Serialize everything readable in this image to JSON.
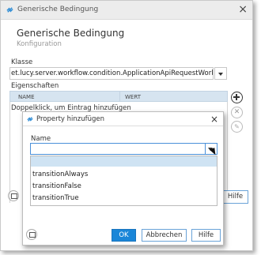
{
  "window": {
    "title": "Generische Bedingung"
  },
  "header": {
    "title": "Generische Bedingung",
    "subtitle": "Konfiguration"
  },
  "klasse": {
    "label": "Klasse",
    "value": "et.lucy.server.workflow.condition.ApplicationApiRequestWorkflowCondition"
  },
  "properties": {
    "label": "Eigenschaften",
    "columns": [
      "NAME",
      "WERT"
    ],
    "empty_hint": "Doppelklick, um Eintrag hinzufügen"
  },
  "outer_footer": {
    "help_label": "Hilfe"
  },
  "dialog": {
    "title": "Property hinzufügen",
    "name_label": "Name",
    "name_value": "",
    "options": [
      "",
      "transitionAlways",
      "transitionFalse",
      "transitionTrue"
    ],
    "ok_label": "OK",
    "cancel_label": "Abbrechen",
    "help_label": "Hilfe"
  },
  "colors": {
    "accent": "#1a86d8",
    "selection": "#cfe3f3",
    "header_row": "#d6e4f0"
  }
}
